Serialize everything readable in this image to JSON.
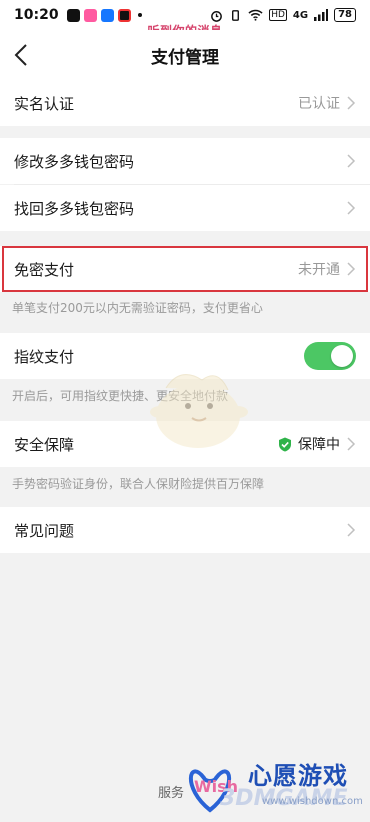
{
  "status_bar": {
    "time": "10:20",
    "battery": "78",
    "network": "4G",
    "overlay_message": "听到你的消息"
  },
  "nav": {
    "title": "支付管理"
  },
  "rows": {
    "real_name": {
      "label": "实名认证",
      "value": "已认证"
    },
    "change_password": {
      "label": "修改多多钱包密码"
    },
    "recover_password": {
      "label": "找回多多钱包密码"
    },
    "password_free": {
      "label": "免密支付",
      "value": "未开通"
    },
    "fingerprint": {
      "label": "指纹支付",
      "toggle_on": true
    },
    "security": {
      "label": "安全保障",
      "value": "保障中"
    },
    "faq": {
      "label": "常见问题"
    }
  },
  "notes": {
    "password_free": "单笔支付200元以内无需验证密码，支付更省心",
    "fingerprint": "开启后，可用指纹更快捷、更安全地付款",
    "security": "手势密码验证身份，联合人保财险提供百万保障"
  },
  "footer": {
    "text": "服务"
  },
  "watermark": {
    "name": "心愿游戏",
    "brand": "3DMGAME",
    "url": "www.wishdown.com"
  },
  "colors": {
    "toggle_on": "#4cc764",
    "highlight": "#d9363e",
    "shield": "#2fb34a"
  }
}
